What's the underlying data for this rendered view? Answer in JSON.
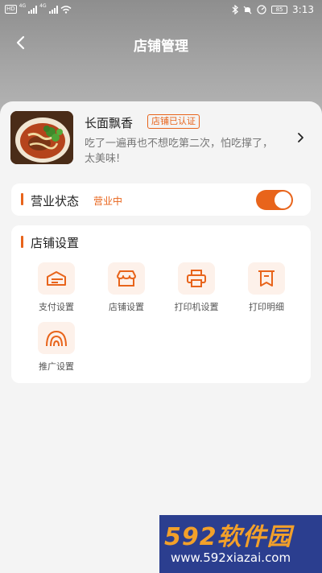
{
  "status_bar": {
    "network_badge": "HD",
    "network_type_1": "4G",
    "network_type_2": "4G",
    "battery": "85",
    "time": "3:13"
  },
  "header": {
    "title": "店铺管理"
  },
  "shop": {
    "name": "长面飘香",
    "verified_badge": "店铺已认证",
    "description": "吃了一遍再也不想吃第二次，怕吃撑了，太美味!"
  },
  "business_status": {
    "label": "营业状态",
    "value": "营业中",
    "toggle_on": true,
    "accent_color": "#e8641b"
  },
  "settings": {
    "title": "店铺设置",
    "items": [
      {
        "label": "支付设置",
        "icon": "payment-icon"
      },
      {
        "label": "店铺设置",
        "icon": "store-icon"
      },
      {
        "label": "打印机设置",
        "icon": "printer-icon"
      },
      {
        "label": "打印明细",
        "icon": "receipt-icon"
      },
      {
        "label": "推广设置",
        "icon": "broadcast-icon"
      }
    ]
  },
  "watermark": {
    "main": "592软件园",
    "sub": "www.592xiazai.com"
  }
}
